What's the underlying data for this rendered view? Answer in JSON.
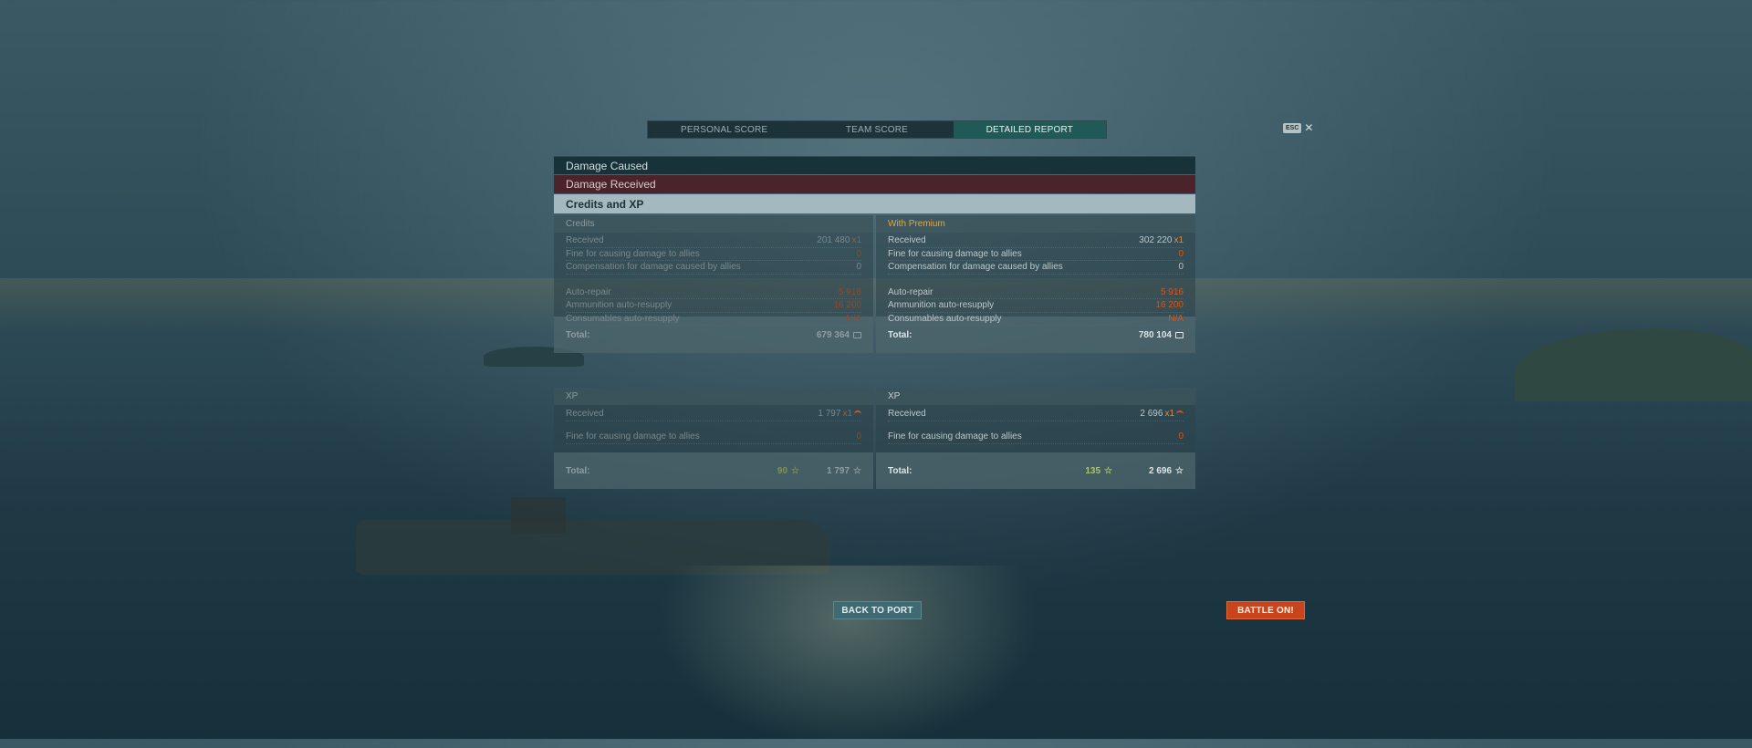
{
  "tabs": [
    {
      "label": "PERSONAL SCORE",
      "active": false
    },
    {
      "label": "TEAM SCORE",
      "active": false
    },
    {
      "label": "DETAILED REPORT",
      "active": true
    }
  ],
  "esc": {
    "key_label": "ESC",
    "close_glyph": "✕"
  },
  "sections": {
    "damage_caused": "Damage Caused",
    "damage_received": "Damage Received",
    "credits_xp": "Credits and XP"
  },
  "credits": {
    "left": {
      "header": "Credits",
      "rows": {
        "received": {
          "label": "Received",
          "value": "201 480",
          "mult": "x1"
        },
        "fine": {
          "label": "Fine for causing damage to allies",
          "value": "0"
        },
        "compensation": {
          "label": "Compensation for damage caused by allies",
          "value": "0"
        },
        "auto_repair": {
          "label": "Auto-repair",
          "value": "5 916"
        },
        "ammo": {
          "label": "Ammunition auto-resupply",
          "value": "16 200"
        },
        "consumables": {
          "label": "Consumables auto-resupply",
          "value": "N/A"
        }
      },
      "total_label": "Total:",
      "total_value": "679 364"
    },
    "right": {
      "header": "With Premium",
      "rows": {
        "received": {
          "label": "Received",
          "value": "302 220",
          "mult": "x1"
        },
        "fine": {
          "label": "Fine for causing damage to allies",
          "value": "0"
        },
        "compensation": {
          "label": "Compensation for damage caused by allies",
          "value": "0"
        },
        "auto_repair": {
          "label": "Auto-repair",
          "value": "5 916"
        },
        "ammo": {
          "label": "Ammunition auto-resupply",
          "value": "16 200"
        },
        "consumables": {
          "label": "Consumables auto-resupply",
          "value": "N/A"
        }
      },
      "total_label": "Total:",
      "total_value": "780 104"
    }
  },
  "xp": {
    "left": {
      "header": "XP",
      "received": {
        "label": "Received",
        "value": "1 797",
        "mult": "x1"
      },
      "fine": {
        "label": "Fine for causing damage to allies",
        "value": "0"
      },
      "total_label": "Total:",
      "free_xp": "90",
      "total_xp": "1 797"
    },
    "right": {
      "header": "XP",
      "received": {
        "label": "Received",
        "value": "2 696",
        "mult": "x1"
      },
      "fine": {
        "label": "Fine for causing damage to allies",
        "value": "0"
      },
      "total_label": "Total:",
      "free_xp": "135",
      "total_xp": "2 696"
    }
  },
  "buttons": {
    "back_to_port": "BACK TO PORT",
    "battle_on": "BATTLE ON!"
  },
  "icons": {
    "credit": "credit-icon",
    "star": "☆",
    "flag": "flag-icon"
  },
  "colors": {
    "accent_tab": "#1f5a57",
    "orange": "#d6551c",
    "premium_gold": "#e0a948",
    "battle_button": "#c9441c"
  }
}
